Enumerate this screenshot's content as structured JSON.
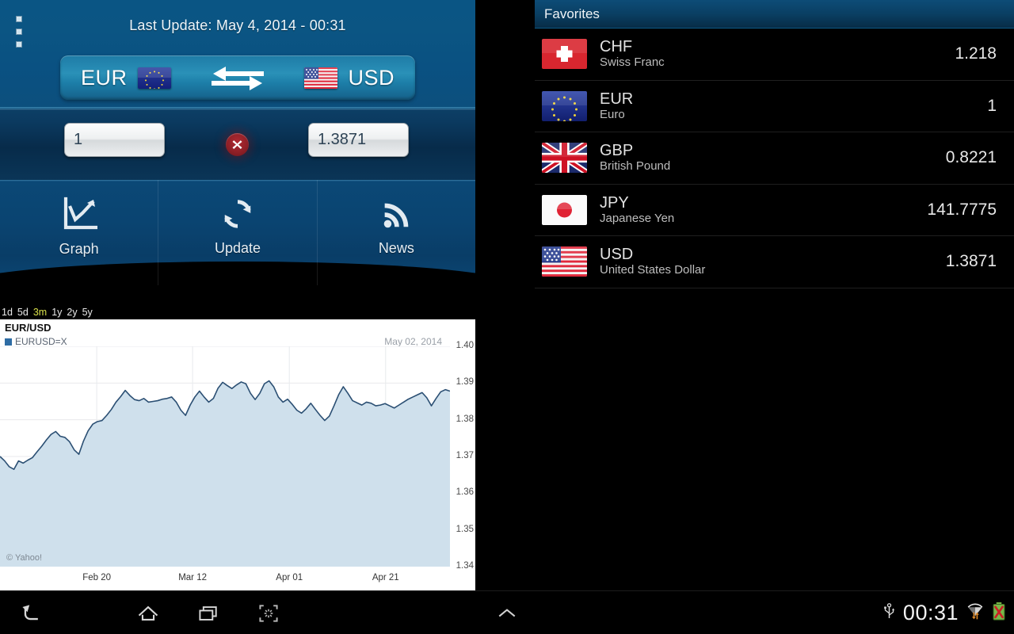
{
  "app": {
    "menu_icon": "overflow-menu-icon",
    "last_update_label": "Last Update: May 4, 2014 - 00:31",
    "pair": {
      "from_code": "EUR",
      "from_flag": "eu-flag",
      "to_code": "USD",
      "to_flag": "us-flag",
      "swap_icon": "swap-arrows-icon"
    },
    "amount": {
      "left_value": "1",
      "left_placeholder": "1",
      "right_value": "1.3871",
      "right_placeholder": "1.3871",
      "multiply_icon": "multiply-icon"
    },
    "actions": [
      {
        "label": "Graph",
        "icon": "line-chart-icon"
      },
      {
        "label": "Update",
        "icon": "refresh-icon"
      },
      {
        "label": "News",
        "icon": "rss-icon"
      }
    ]
  },
  "ranges": {
    "items": [
      "1d",
      "5d",
      "3m",
      "1y",
      "2y",
      "5y"
    ],
    "selected": "3m",
    "selected_color": "#d8e04a"
  },
  "chart_data": {
    "type": "area",
    "title": "EUR/USD",
    "legend": [
      "EURUSD=X"
    ],
    "legend_position": "top-left",
    "annotation": "May 02, 2014",
    "watermark": "© Yahoo!",
    "xlabel": "",
    "ylabel": "",
    "ylim": [
      1.34,
      1.4
    ],
    "ytick_labels": [
      "1.40",
      "1.39",
      "1.38",
      "1.37",
      "1.36",
      "1.35",
      "1.34"
    ],
    "ytick_values": [
      1.4,
      1.39,
      1.38,
      1.37,
      1.36,
      1.35,
      1.34
    ],
    "xtick_labels": [
      "Feb 20",
      "Mar 12",
      "Apr 01",
      "Apr 21"
    ],
    "xtick_positions": [
      0.215,
      0.428,
      0.643,
      0.857
    ],
    "grid": true,
    "line_color": "#2b4f73",
    "fill_color": "#cfe0ec",
    "values": [
      1.37,
      1.3688,
      1.3672,
      1.3665,
      1.3688,
      1.3682,
      1.369,
      1.3697,
      1.3713,
      1.3728,
      1.3745,
      1.376,
      1.3768,
      1.3755,
      1.3752,
      1.374,
      1.3718,
      1.3706,
      1.3742,
      1.377,
      1.3788,
      1.3795,
      1.3798,
      1.3812,
      1.3828,
      1.3848,
      1.3863,
      1.388,
      1.3866,
      1.3855,
      1.3852,
      1.3858,
      1.3848,
      1.385,
      1.3852,
      1.3856,
      1.3858,
      1.3862,
      1.3848,
      1.3826,
      1.3812,
      1.384,
      1.3862,
      1.3878,
      1.3862,
      1.3848,
      1.3858,
      1.3886,
      1.3902,
      1.3893,
      1.3885,
      1.3895,
      1.3903,
      1.3898,
      1.3872,
      1.3855,
      1.3872,
      1.3898,
      1.3906,
      1.389,
      1.3862,
      1.3848,
      1.3856,
      1.3842,
      1.3826,
      1.3818,
      1.383,
      1.3845,
      1.3828,
      1.3812,
      1.3798,
      1.381,
      1.3838,
      1.3868,
      1.389,
      1.3872,
      1.3852,
      1.3846,
      1.384,
      1.3848,
      1.3845,
      1.3838,
      1.384,
      1.3844,
      1.3838,
      1.3832,
      1.384,
      1.3848,
      1.3856,
      1.3862,
      1.3868,
      1.3874,
      1.386,
      1.3838,
      1.3858,
      1.3876,
      1.3882,
      1.3878
    ]
  },
  "favorites": {
    "header": "Favorites",
    "rows": [
      {
        "code": "CHF",
        "name": "Swiss Franc",
        "rate": "1.218",
        "flag": "ch-flag"
      },
      {
        "code": "EUR",
        "name": "Euro",
        "rate": "1",
        "flag": "eu-flag"
      },
      {
        "code": "GBP",
        "name": "British Pound",
        "rate": "0.8221",
        "flag": "gb-flag"
      },
      {
        "code": "JPY",
        "name": "Japanese Yen",
        "rate": "141.7775",
        "flag": "jp-flag"
      },
      {
        "code": "USD",
        "name": "United States Dollar",
        "rate": "1.3871",
        "flag": "us-flag"
      }
    ]
  },
  "navbar": {
    "back_icon": "back-arrow-icon",
    "home_icon": "home-icon",
    "recent_icon": "recent-apps-icon",
    "screenshot_icon": "screenshot-icon",
    "expand_icon": "chevron-up-icon",
    "usb_icon": "usb-icon",
    "clock": "00:31",
    "wifi_icon": "wifi-transfer-icon",
    "battery_icon": "battery-error-icon"
  }
}
